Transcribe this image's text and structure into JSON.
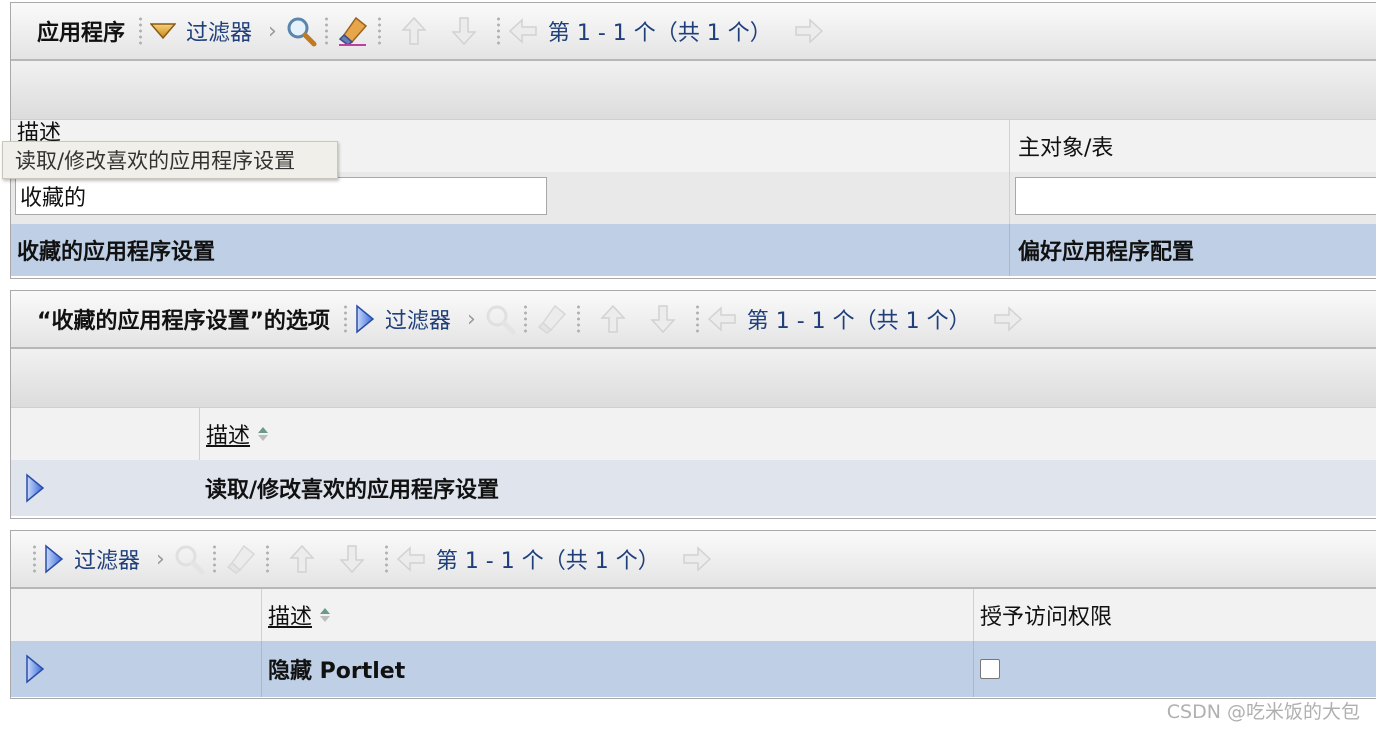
{
  "panel1": {
    "title": "应用程序",
    "filter_label": "过滤器",
    "pager_text": "第 1 - 1 个（共 1 个）",
    "col_desc_header": "描述",
    "col_main_header": "主对象/表",
    "tooltip": "读取/修改喜欢的应用程序设置",
    "desc_filter_value": "收藏的",
    "main_filter_value": "",
    "row": {
      "desc": "收藏的应用程序设置",
      "main": "偏好应用程序配置"
    }
  },
  "panel2": {
    "title": "“收藏的应用程序设置”的选项",
    "filter_label": "过滤器",
    "pager_text": "第 1 - 1 个（共 1 个）",
    "col_desc_header": "描述",
    "row": {
      "desc": "读取/修改喜欢的应用程序设置"
    }
  },
  "panel3": {
    "filter_label": "过滤器",
    "pager_text": "第 1 - 1 个（共 1 个）",
    "col_desc_header": "描述",
    "col_grant_header": "授予访问权限",
    "row": {
      "desc": "隐藏 Portlet",
      "granted": false
    }
  },
  "watermark": "CSDN @吃米饭的大包",
  "colors": {
    "link": "#1f3f7a",
    "row_selected": "#bfd0e6",
    "row_highlight": "#dfe4ed",
    "header_row": "#f2f2f2",
    "triangle": "#3a6ad8"
  }
}
